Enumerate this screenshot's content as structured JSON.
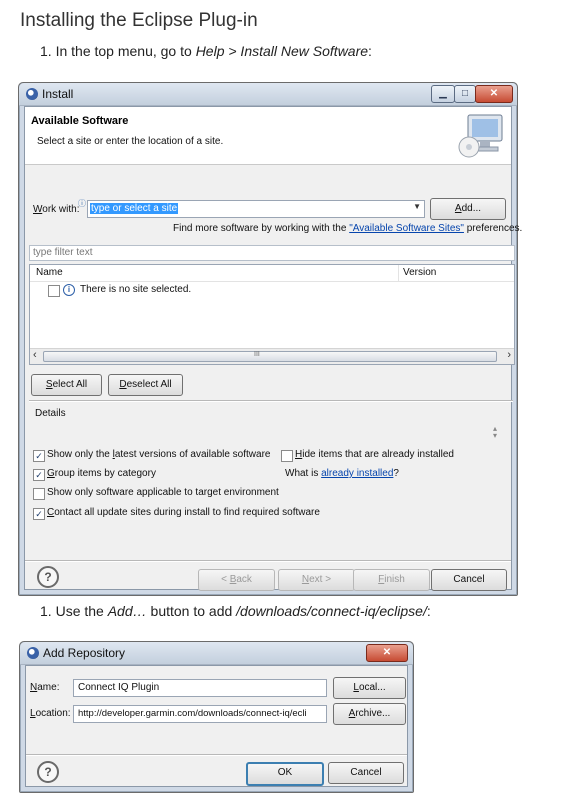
{
  "doc": {
    "title": "Installing the Eclipse Plug-in",
    "step1_num": "1.",
    "step1_pre": "In the top menu, go to",
    "step1_path": "Help > Install New Software",
    "step1_post": ":",
    "step2_num": "1.",
    "step2_pre": "Use the",
    "step2_button": "Add…",
    "step2_mid": "button to add",
    "step2_path": "/downloads/connect-iq/eclipse/",
    "step2_post": ":"
  },
  "install_dialog": {
    "window_title": "Install",
    "minimize": "▁",
    "maximize": "□",
    "close": "✕",
    "heading": "Available Software",
    "subheading": "Select a site or enter the location of a site.",
    "work_with_label": "Work with:",
    "work_with_value": "type or select a site",
    "add_button": "Add...",
    "find_more_pre": "Find more software by working with the",
    "find_more_link": "\"Available Software Sites\"",
    "find_more_post": "preferences.",
    "filter_placeholder": "type filter text",
    "col_name": "Name",
    "col_version": "Version",
    "no_site_text": "There is no site selected.",
    "select_all": "Select All",
    "deselect_all": "Deselect All",
    "details_label": "Details",
    "opt_latest": "Show only the latest versions of available software",
    "opt_hide_installed": "Hide items that are already installed",
    "opt_group": "Group items by category",
    "what_is_pre": "What is",
    "what_is_link": "already installed",
    "what_is_post": "?",
    "opt_target_env": "Show only software applicable to target environment",
    "opt_contact": "Contact all update sites during install to find required software",
    "back_button": "< Back",
    "next_button": "Next >",
    "finish_button": "Finish",
    "cancel_button": "Cancel",
    "checkbox_mark": "✓",
    "scroll_left": "‹",
    "scroll_right": "›",
    "scroll_grip": "III",
    "help_glyph": "?"
  },
  "repo_dialog": {
    "window_title": "Add Repository",
    "close": "✕",
    "name_label": "Name:",
    "name_value": "Connect IQ Plugin",
    "local_button": "Local...",
    "location_label": "Location:",
    "location_value": "http://developer.garmin.com/downloads/connect-iq/ecli",
    "archive_button": "Archive...",
    "ok_button": "OK",
    "cancel_button": "Cancel",
    "help_glyph": "?"
  }
}
